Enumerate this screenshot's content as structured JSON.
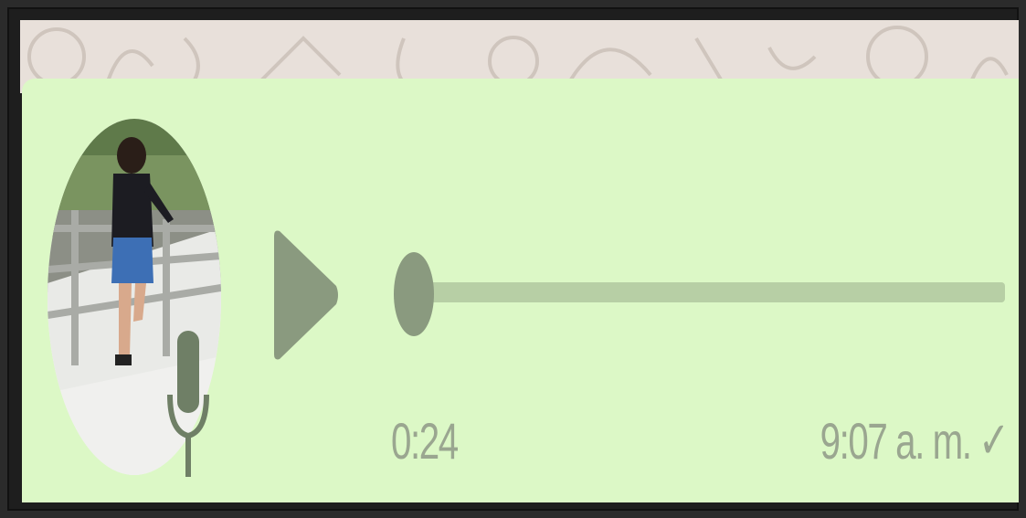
{
  "voice_message": {
    "duration": "0:24",
    "timestamp": "9:07 a. m.",
    "status_icon": "single-check-icon",
    "play_icon": "play-icon",
    "mic_icon": "microphone-icon",
    "progress": 0.0
  },
  "colors": {
    "bubble": "#dcf8c6",
    "chat_background": "#e8e0da",
    "accent": "#8a9a7f",
    "track": "#b7cfa5",
    "meta_text": "#9aa690"
  }
}
